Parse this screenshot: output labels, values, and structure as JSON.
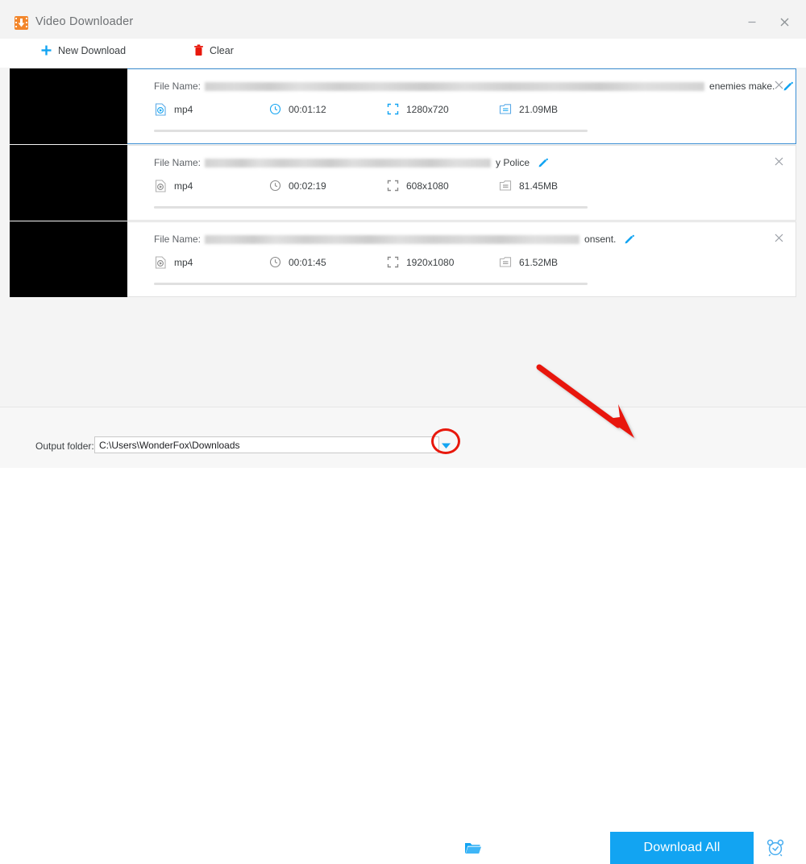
{
  "window": {
    "title": "Video Downloader",
    "app_icon": "download-arrow-icon",
    "minimize_label": "–",
    "close_label": "×"
  },
  "toolbar": {
    "new_download_label": "New Download",
    "new_download_icon": "plus-icon",
    "clear_label": "Clear",
    "clear_icon": "trash-icon"
  },
  "list": {
    "filename_label": "File Name:",
    "edit_icon": "pencil-icon",
    "close_icon": "close-icon",
    "items": [
      {
        "filename_tail": "enemies make.",
        "redacted_width": 620,
        "format": "mp4",
        "duration": "00:01:12",
        "resolution": "1280x720",
        "filesize": "21.09MB",
        "selected": true
      },
      {
        "filename_tail": "y Police",
        "redacted_width": 355,
        "format": "mp4",
        "duration": "00:02:19",
        "resolution": "608x1080",
        "filesize": "81.45MB",
        "selected": false
      },
      {
        "filename_tail": "onsent.",
        "redacted_width": 465,
        "format": "mp4",
        "duration": "00:01:45",
        "resolution": "1920x1080",
        "filesize": "61.52MB",
        "selected": false
      }
    ]
  },
  "bottom": {
    "output_folder_label": "Output folder:",
    "output_folder_value": "C:\\Users\\WonderFox\\Downloads",
    "dropdown_icon": "chevron-down-icon",
    "browse_icon": "folder-icon",
    "download_all_label": "Download All",
    "schedule_icon": "alarm-clock-icon"
  },
  "annotations": {
    "arrow_color": "#e8180c",
    "circle_color": "#e8180c",
    "accent_color": "#12a4f2"
  }
}
